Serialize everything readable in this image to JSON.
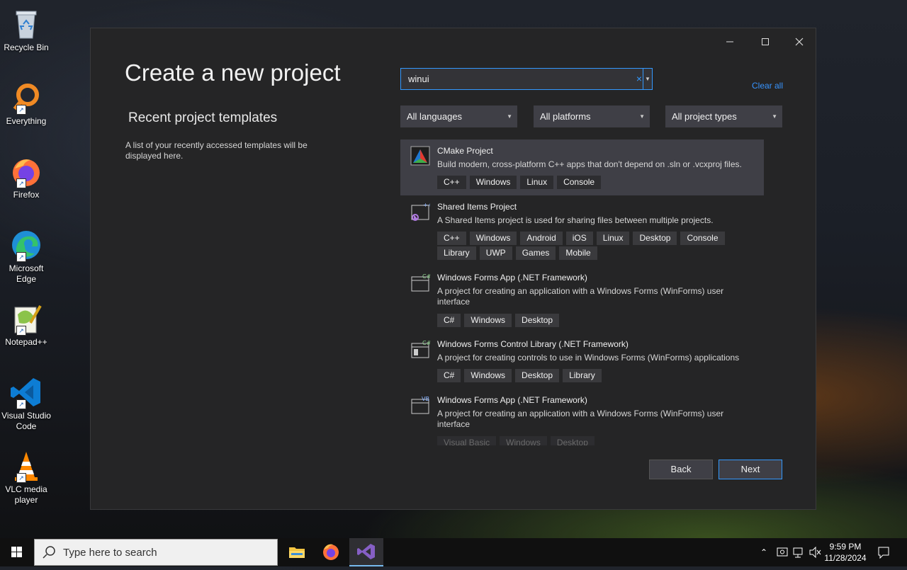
{
  "desktop": {
    "icons": [
      {
        "label": "Recycle Bin"
      },
      {
        "label": "Everything"
      },
      {
        "label": "Firefox"
      },
      {
        "label": "Microsoft Edge"
      },
      {
        "label": "Notepad++"
      },
      {
        "label": "Visual Studio Code"
      },
      {
        "label": "VLC media player"
      }
    ]
  },
  "dialog": {
    "title": "Create a new project",
    "recent_title": "Recent project templates",
    "recent_desc": "A list of your recently accessed templates will be displayed here.",
    "search": {
      "value": "winui",
      "clear_glyph": "×"
    },
    "clear_all": "Clear all",
    "filters": {
      "language": "All languages",
      "platform": "All platforms",
      "project_type": "All project types"
    },
    "templates": [
      {
        "name": "CMake Project",
        "desc": "Build modern, cross-platform C++ apps that don't depend on .sln or .vcxproj files.",
        "tags": [
          "C++",
          "Windows",
          "Linux",
          "Console"
        ],
        "selected": true
      },
      {
        "name": "Shared Items Project",
        "desc": "A Shared Items project is used for sharing files between multiple projects.",
        "tags": [
          "C++",
          "Windows",
          "Android",
          "iOS",
          "Linux",
          "Desktop",
          "Console",
          "Library",
          "UWP",
          "Games",
          "Mobile"
        ]
      },
      {
        "name": "Windows Forms App (.NET Framework)",
        "desc": "A project for creating an application with a Windows Forms (WinForms) user interface",
        "tags": [
          "C#",
          "Windows",
          "Desktop"
        ]
      },
      {
        "name": "Windows Forms Control Library (.NET Framework)",
        "desc": "A project for creating controls to use in Windows Forms (WinForms) applications",
        "tags": [
          "C#",
          "Windows",
          "Desktop",
          "Library"
        ]
      },
      {
        "name": "Windows Forms App (.NET Framework)",
        "desc": "A project for creating an application with a Windows Forms (WinForms) user interface",
        "tags": [
          "Visual Basic",
          "Windows",
          "Desktop"
        ]
      }
    ],
    "back_label": "Back",
    "next_label": "Next"
  },
  "taskbar": {
    "search_placeholder": "Type here to search",
    "time": "9:59 PM",
    "date": "11/28/2024"
  },
  "colors": {
    "accent": "#3399ff",
    "dialog_bg": "#252526",
    "vs_purple": "#865fc5"
  }
}
